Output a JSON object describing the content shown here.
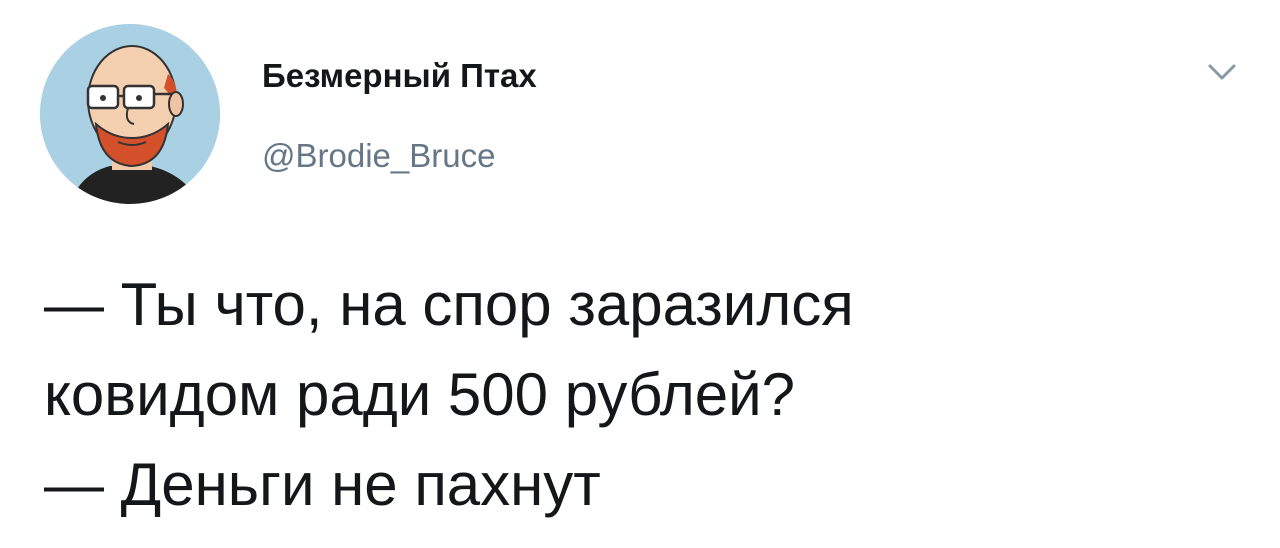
{
  "tweet": {
    "author": {
      "display_name": "Безмерный Птах",
      "username": "@Brodie_Bruce",
      "avatar_icon": "cartoon-man-avatar"
    },
    "menu_icon": "chevron-down-icon",
    "text_lines": [
      "— Ты что, на спор заразился",
      "ковидом ради 500 рублей?",
      "— Деньги не пахнут"
    ]
  },
  "colors": {
    "background": "#ffffff",
    "text": "#14171a",
    "secondary_text": "#657786",
    "avatar_bg": "#a9d1e3",
    "beard": "#d4502a"
  }
}
